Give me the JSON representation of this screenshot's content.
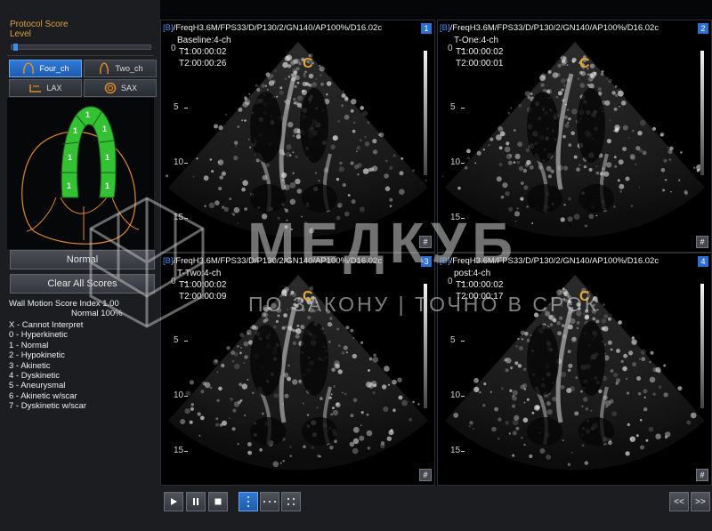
{
  "left_panel": {
    "protocol_score_label": "Protocol Score",
    "level_label": "Level",
    "level_value": 0.02,
    "views": [
      {
        "label": "Four_ch",
        "icon": "four-chamber-icon",
        "active": true
      },
      {
        "label": "Two_ch",
        "icon": "two-chamber-icon",
        "active": false
      },
      {
        "label": "LAX",
        "icon": "lax-icon",
        "active": false
      },
      {
        "label": "SAX",
        "icon": "sax-icon",
        "active": false
      }
    ],
    "segment_scores": [
      "1",
      "1",
      "1",
      "1",
      "1",
      "1",
      "1"
    ],
    "segment_color": "#34c234",
    "outline_color": "#e08a2a",
    "normal_button": "Normal",
    "clear_button": "Clear All Scores",
    "wms_label": "Wall Motion Score Index 1.00",
    "wms_normal": "Normal 100%",
    "legend": [
      "X - Cannot Interpret",
      "0 - Hyperkinetic",
      "1 - Normal",
      "2 - Hypokinetic",
      "3 - Akinetic",
      "4 - Dyskinetic",
      "5 - Aneurysmal",
      "6 - Akinetic w/scar",
      "7 - Dyskinetic w/scar"
    ]
  },
  "quadrants": [
    {
      "bracket": "[B]",
      "params": "/FreqH3.6M/FPS33/D/P130/2/GN140/AP100%/D16.02c",
      "number": "1",
      "view": "Baseline:4-ch",
      "t1": "T1:00:00:02",
      "t2": "T2:00:00:26",
      "marker": "C"
    },
    {
      "bracket": "[B]",
      "params": "/FreqH3.6M/FPS33/D/P130/2/GN140/AP100%/D16.02c",
      "number": "2",
      "view": "T-One:4-ch",
      "t1": "T1:00:00:02",
      "t2": "T2:00:00:01",
      "marker": "C"
    },
    {
      "bracket": "[B]",
      "params": "/FreqH3.6M/FPS33/D/P130/2/GN140/AP100%/D16.02c",
      "number": "3",
      "view": "T-Two:4-ch",
      "t1": "T1:00:00:02",
      "t2": "T2:00:00:09",
      "marker": "C"
    },
    {
      "bracket": "[B]",
      "params": "/FreqH3.6M/FPS33/D/P130/2/GN140/AP100%/D16.02c",
      "number": "4",
      "view": "post:4-ch",
      "t1": "T1:00:00:02",
      "t2": "T2:00:00:17",
      "marker": "C"
    }
  ],
  "depth_ticks": [
    "0",
    "5",
    "10",
    "15"
  ],
  "hash_label": "#",
  "toolbar": {
    "play_icon": "play-icon",
    "pause_icon": "pause-icon",
    "stop_icon": "stop-icon",
    "prev_label": "<<",
    "next_label": ">>"
  },
  "watermark": {
    "title": "МЕДКУБ",
    "subtitle": "ПО ЗАКОНУ | ТОЧНО В СРОК"
  }
}
